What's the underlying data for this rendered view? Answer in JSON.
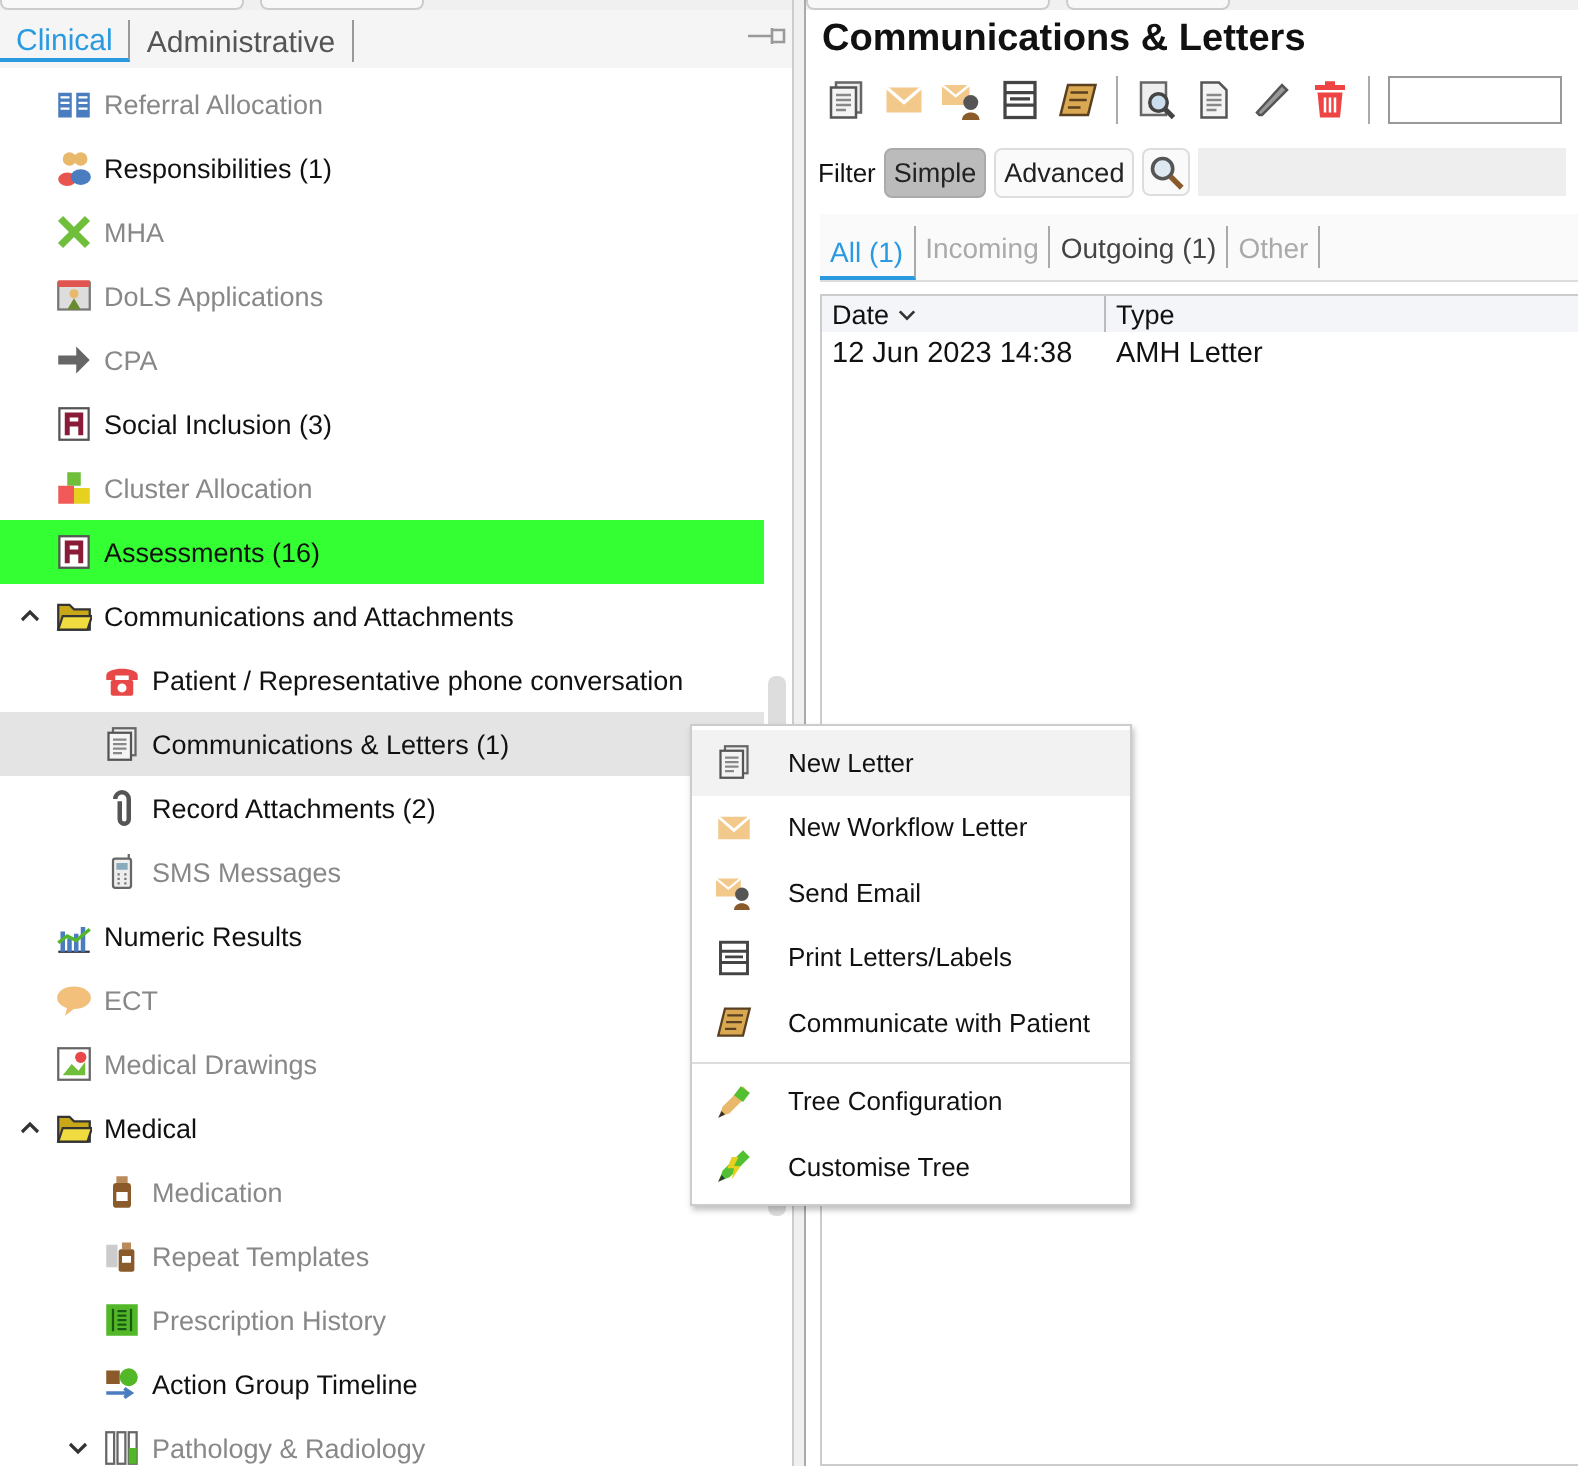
{
  "nav_tabs": [
    {
      "label": "Clinical",
      "selected": true
    },
    {
      "label": "Administrative",
      "selected": false
    }
  ],
  "tree": [
    {
      "label": "Referral Allocation",
      "kind": "columns",
      "enabled": false,
      "selected": false,
      "highlighted": false
    },
    {
      "label": "Responsibilities (1)",
      "kind": "people",
      "enabled": true,
      "selected": false,
      "highlighted": false
    },
    {
      "label": "MHA",
      "kind": "cross",
      "enabled": false,
      "selected": false,
      "highlighted": false
    },
    {
      "label": "DoLS Applications",
      "kind": "easel",
      "enabled": false,
      "selected": false,
      "highlighted": false
    },
    {
      "label": "CPA",
      "kind": "arrow",
      "enabled": false,
      "selected": false,
      "highlighted": false
    },
    {
      "label": "Social Inclusion (3)",
      "kind": "form",
      "enabled": true,
      "selected": false,
      "highlighted": false
    },
    {
      "label": "Cluster Allocation",
      "kind": "blocks",
      "enabled": false,
      "selected": false,
      "highlighted": false
    },
    {
      "label": "Assessments (16)",
      "kind": "form",
      "enabled": true,
      "selected": true,
      "highlighted": false
    },
    {
      "label": "Communications and Attachments",
      "kind": "folder",
      "enabled": true,
      "selected": false,
      "highlighted": false,
      "expanded": true,
      "children": [
        {
          "label": "Patient / Representative phone conversation",
          "kind": "phone",
          "enabled": true,
          "selected": false,
          "highlighted": false
        },
        {
          "label": "Communications & Letters (1)",
          "kind": "letter",
          "enabled": true,
          "selected": false,
          "highlighted": true
        },
        {
          "label": "Record Attachments (2)",
          "kind": "clip",
          "enabled": true,
          "selected": false,
          "highlighted": false
        },
        {
          "label": "SMS Messages",
          "kind": "mobile",
          "enabled": false,
          "selected": false,
          "highlighted": false
        }
      ]
    },
    {
      "label": "Numeric Results",
      "kind": "chart",
      "enabled": true,
      "selected": false,
      "highlighted": false
    },
    {
      "label": "ECT",
      "kind": "bubble",
      "enabled": false,
      "selected": false,
      "highlighted": false
    },
    {
      "label": "Medical Drawings",
      "kind": "drawing",
      "enabled": false,
      "selected": false,
      "highlighted": false
    },
    {
      "label": "Medical",
      "kind": "folder",
      "enabled": true,
      "selected": false,
      "highlighted": false,
      "expanded": true,
      "children": [
        {
          "label": "Medication",
          "kind": "bottle",
          "enabled": false,
          "selected": false,
          "highlighted": false
        },
        {
          "label": "Repeat Templates",
          "kind": "bottles",
          "enabled": false,
          "selected": false,
          "highlighted": false
        },
        {
          "label": "Prescription History",
          "kind": "grid",
          "enabled": false,
          "selected": false,
          "highlighted": false
        },
        {
          "label": "Action Group Timeline",
          "kind": "timeline",
          "enabled": true,
          "selected": false,
          "highlighted": false
        },
        {
          "label": "Pathology & Radiology",
          "kind": "tubes",
          "enabled": false,
          "selected": false,
          "highlighted": false,
          "expanded": false
        }
      ]
    }
  ],
  "panel": {
    "title": "Communications & Letters",
    "toolbar": [
      {
        "kind": "letter"
      },
      {
        "kind": "envelope"
      },
      {
        "kind": "email"
      },
      {
        "kind": "printer"
      },
      {
        "kind": "scroll"
      },
      {
        "kind": "sep"
      },
      {
        "kind": "search-doc"
      },
      {
        "kind": "document"
      },
      {
        "kind": "pencil-grey"
      },
      {
        "kind": "trash"
      },
      {
        "kind": "sep"
      }
    ],
    "filter": {
      "label": "Filter",
      "modes": [
        {
          "label": "Simple",
          "selected": true
        },
        {
          "label": "Advanced",
          "selected": false
        }
      ]
    },
    "tabs": [
      {
        "label": "All (1)",
        "selected": true,
        "enabled": true
      },
      {
        "label": "Incoming",
        "selected": false,
        "enabled": false
      },
      {
        "label": "Outgoing (1)",
        "selected": false,
        "enabled": true
      },
      {
        "label": "Other",
        "selected": false,
        "enabled": false
      }
    ],
    "table": {
      "columns": [
        "Date",
        "Type"
      ],
      "rows": [
        [
          "12 Jun 2023 14:38",
          "AMH Letter"
        ]
      ]
    }
  },
  "context_menu": {
    "groups": [
      [
        {
          "label": "New Letter",
          "kind": "letter",
          "highlighted": true
        },
        {
          "label": "New Workflow Letter",
          "kind": "envelope",
          "highlighted": false
        },
        {
          "label": "Send Email",
          "kind": "email",
          "highlighted": false
        },
        {
          "label": "Print Letters/Labels",
          "kind": "printer",
          "highlighted": false
        },
        {
          "label": "Communicate with Patient",
          "kind": "scroll",
          "highlighted": false
        }
      ],
      [
        {
          "label": "Tree Configuration",
          "kind": "pencil",
          "highlighted": false
        },
        {
          "label": "Customise Tree",
          "kind": "pencil-bolt",
          "highlighted": false
        }
      ]
    ]
  }
}
